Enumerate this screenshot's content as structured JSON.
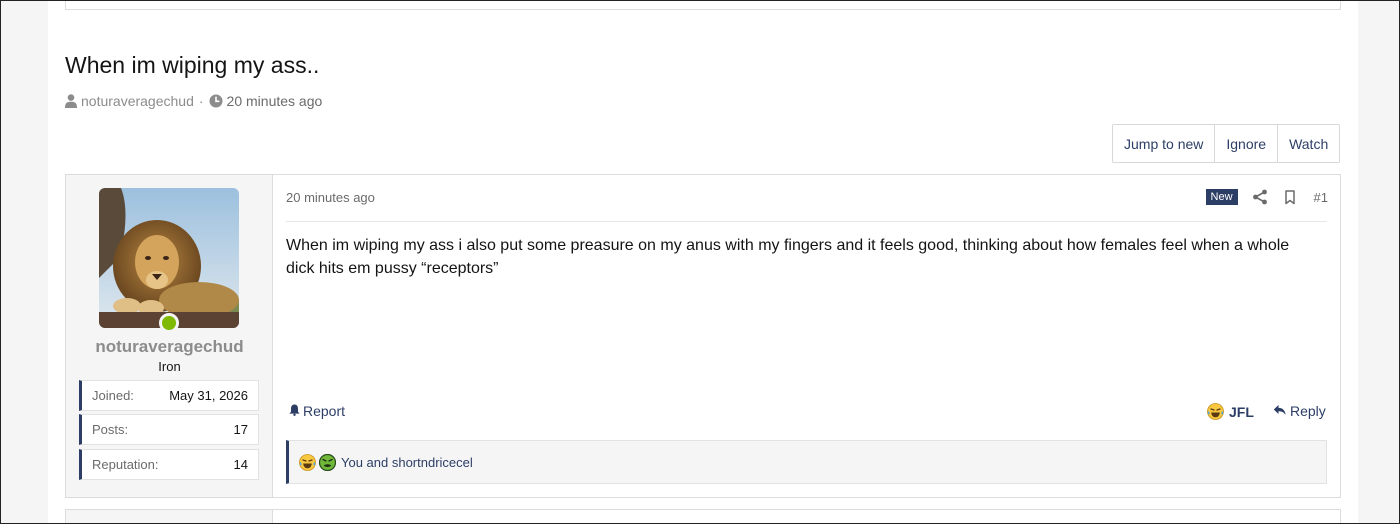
{
  "thread": {
    "title": "When im wiping my ass..",
    "author": "noturaveragechud",
    "separator": "·",
    "time": "20 minutes ago"
  },
  "actions": {
    "jump_to_new": "Jump to new",
    "ignore": "Ignore",
    "watch": "Watch"
  },
  "post": {
    "time": "20 minutes ago",
    "badge": "New",
    "number": "#1",
    "body": "When im wiping my ass i also put some preasure on my anus with my fingers and it feels good, thinking about how females feel when a whole dick hits em pussy “receptors”",
    "report": "Report",
    "reaction_label": "JFL",
    "reply": "Reply",
    "reactions_summary": "You and shortndricecel"
  },
  "user": {
    "name": "noturaveragechud",
    "title": "Iron",
    "online": true,
    "stats": [
      {
        "label": "Joined:",
        "value": "May 31, 2026"
      },
      {
        "label": "Posts:",
        "value": "17"
      },
      {
        "label": "Reputation:",
        "value": "14"
      }
    ]
  },
  "icons": {
    "author": "user-icon",
    "time": "clock-icon",
    "share": "share-icon",
    "bookmark": "bookmark-icon",
    "report": "bell-icon",
    "reply": "reply-arrow-icon",
    "reaction_laugh": "laughing-crying-emoji-icon",
    "reaction_sick": "nauseated-emoji-icon"
  },
  "colors": {
    "accent": "#2d3e66",
    "online": "#7fb900",
    "muted": "#8c8c8c"
  }
}
